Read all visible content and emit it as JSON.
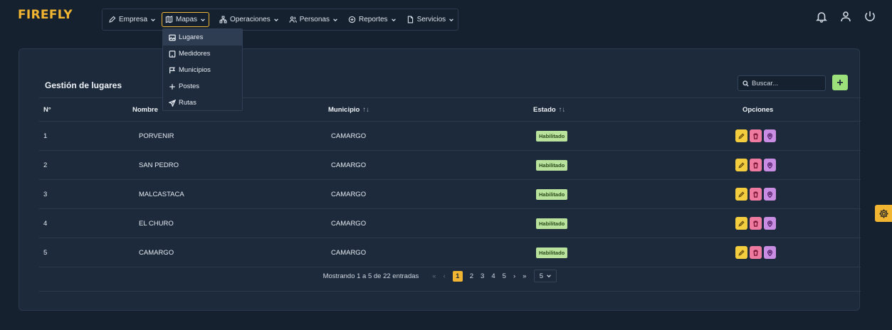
{
  "brand": "FIREFLY",
  "nav": {
    "items": [
      {
        "label": "Empresa",
        "icon": "pencil-icon"
      },
      {
        "label": "Mapas",
        "icon": "map-icon"
      },
      {
        "label": "Operaciones",
        "icon": "network-icon"
      },
      {
        "label": "Personas",
        "icon": "users-icon"
      },
      {
        "label": "Reportes",
        "icon": "print-icon"
      },
      {
        "label": "Servicios",
        "icon": "file-icon"
      }
    ],
    "active": "Mapas"
  },
  "dropdown": {
    "items": [
      {
        "label": "Lugares",
        "icon": "image-icon"
      },
      {
        "label": "Medidores",
        "icon": "tablet-icon"
      },
      {
        "label": "Municipios",
        "icon": "flag-icon"
      },
      {
        "label": "Postes",
        "icon": "plus-icon"
      },
      {
        "label": "Rutas",
        "icon": "send-icon"
      }
    ],
    "active": "Lugares"
  },
  "page": {
    "title": "Gestión de lugares",
    "search_placeholder": "Buscar...",
    "columns": {
      "num": "N°",
      "name": "Nombre",
      "municipio": "Municipio",
      "estado": "Estado",
      "opciones": "Opciones",
      "sort_glyph": "↑↓"
    },
    "rows": [
      {
        "num": "1",
        "name": "PORVENIR",
        "municipio": "CAMARGO",
        "estado": "Habilitado"
      },
      {
        "num": "2",
        "name": "SAN PEDRO",
        "municipio": "CAMARGO",
        "estado": "Habilitado"
      },
      {
        "num": "3",
        "name": "MALCASTACA",
        "municipio": "CAMARGO",
        "estado": "Habilitado"
      },
      {
        "num": "4",
        "name": "EL CHURO",
        "municipio": "CAMARGO",
        "estado": "Habilitado"
      },
      {
        "num": "5",
        "name": "CAMARGO",
        "municipio": "CAMARGO",
        "estado": "Habilitado"
      }
    ]
  },
  "pagination": {
    "info": "Mostrando 1 a 5 de 22 entradas",
    "first": "«",
    "prev": "‹",
    "pages": [
      "1",
      "2",
      "3",
      "4",
      "5"
    ],
    "current": "1",
    "next": "›",
    "last": "»",
    "page_size": "5"
  },
  "colors": {
    "accent": "#f2b531",
    "background": "#16212f",
    "card": "#1d2a3b",
    "badge": "#b9e39c",
    "edit": "#f4cd3f",
    "delete": "#ef7aa0",
    "location": "#c98ee3",
    "add": "#9be07a"
  }
}
